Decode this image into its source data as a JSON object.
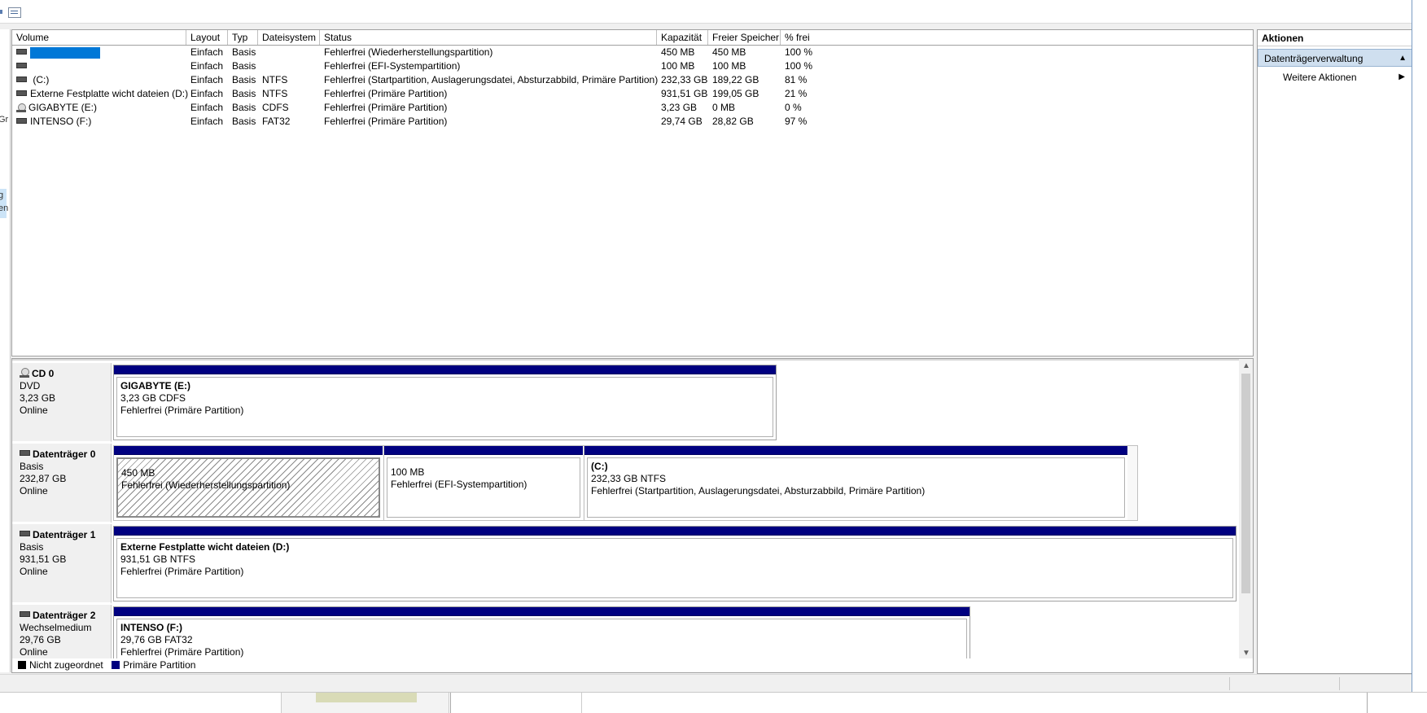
{
  "volume_list": {
    "columns": [
      "Volume",
      "Layout",
      "Typ",
      "Dateisystem",
      "Status",
      "Kapazität",
      "Freier Speicher",
      "% frei"
    ],
    "rows": [
      {
        "volume": "",
        "layout": "Einfach",
        "typ": "Basis",
        "fs": "",
        "status": "Fehlerfrei (Wiederherstellungspartition)",
        "cap": "450 MB",
        "free": "450 MB",
        "pct": "100 %",
        "icon": "disk-icon"
      },
      {
        "volume": "",
        "layout": "Einfach",
        "typ": "Basis",
        "fs": "",
        "status": "Fehlerfrei (EFI-Systempartition)",
        "cap": "100 MB",
        "free": "100 MB",
        "pct": "100 %",
        "icon": "disk-icon"
      },
      {
        "volume": " (C:)",
        "layout": "Einfach",
        "typ": "Basis",
        "fs": "NTFS",
        "status": "Fehlerfrei (Startpartition, Auslagerungsdatei, Absturzabbild, Primäre Partition)",
        "cap": "232,33 GB",
        "free": "189,22 GB",
        "pct": "81 %",
        "icon": "disk-icon"
      },
      {
        "volume": "Externe Festplatte wicht dateien (D:)",
        "layout": "Einfach",
        "typ": "Basis",
        "fs": "NTFS",
        "status": "Fehlerfrei (Primäre Partition)",
        "cap": "931,51 GB",
        "free": "199,05 GB",
        "pct": "21 %",
        "icon": "disk-icon"
      },
      {
        "volume": "GIGABYTE (E:)",
        "layout": "Einfach",
        "typ": "Basis",
        "fs": "CDFS",
        "status": "Fehlerfrei (Primäre Partition)",
        "cap": "3,23 GB",
        "free": "0 MB",
        "pct": "0 %",
        "icon": "cd-icon"
      },
      {
        "volume": "INTENSO (F:)",
        "layout": "Einfach",
        "typ": "Basis",
        "fs": "FAT32",
        "status": "Fehlerfrei (Primäre Partition)",
        "cap": "29,74 GB",
        "free": "28,82 GB",
        "pct": "97 %",
        "icon": "disk-icon"
      }
    ]
  },
  "disks": [
    {
      "name": "CD 0",
      "type": "DVD",
      "size": "3,23 GB",
      "state": "Online",
      "partitions": [
        {
          "name": "GIGABYTE  (E:)",
          "size_fs": "3,23 GB CDFS",
          "status": "Fehlerfrei (Primäre Partition)"
        }
      ]
    },
    {
      "name": "Datenträger 0",
      "type": "Basis",
      "size": "232,87 GB",
      "state": "Online",
      "partitions": [
        {
          "name": "",
          "size_fs": "450 MB",
          "status": "Fehlerfrei (Wiederherstellungspartition)"
        },
        {
          "name": "",
          "size_fs": "100 MB",
          "status": "Fehlerfrei (EFI-Systempartition)"
        },
        {
          "name": " (C:)",
          "size_fs": "232,33 GB NTFS",
          "status": "Fehlerfrei (Startpartition, Auslagerungsdatei, Absturzabbild, Primäre Partition)"
        }
      ]
    },
    {
      "name": "Datenträger 1",
      "type": "Basis",
      "size": "931,51 GB",
      "state": "Online",
      "partitions": [
        {
          "name": "Externe Festplatte wicht dateien  (D:)",
          "size_fs": "931,51 GB NTFS",
          "status": "Fehlerfrei (Primäre Partition)"
        }
      ]
    },
    {
      "name": "Datenträger 2",
      "type": "Wechselmedium",
      "size": "29,76 GB",
      "state": "Online",
      "partitions": [
        {
          "name": "INTENSO  (F:)",
          "size_fs": "29,76 GB FAT32",
          "status": "Fehlerfrei (Primäre Partition)"
        }
      ]
    }
  ],
  "legend": {
    "unallocated": "Nicht zugeordnet",
    "primary": "Primäre Partition",
    "unallocated_color": "#000000",
    "primary_color": "#000080"
  },
  "actions": {
    "header": "Aktionen",
    "section": "Datenträgerverwaltung",
    "more": "Weitere Aktionen"
  },
  "left_fragments": [
    "Gr",
    "g",
    "en"
  ]
}
